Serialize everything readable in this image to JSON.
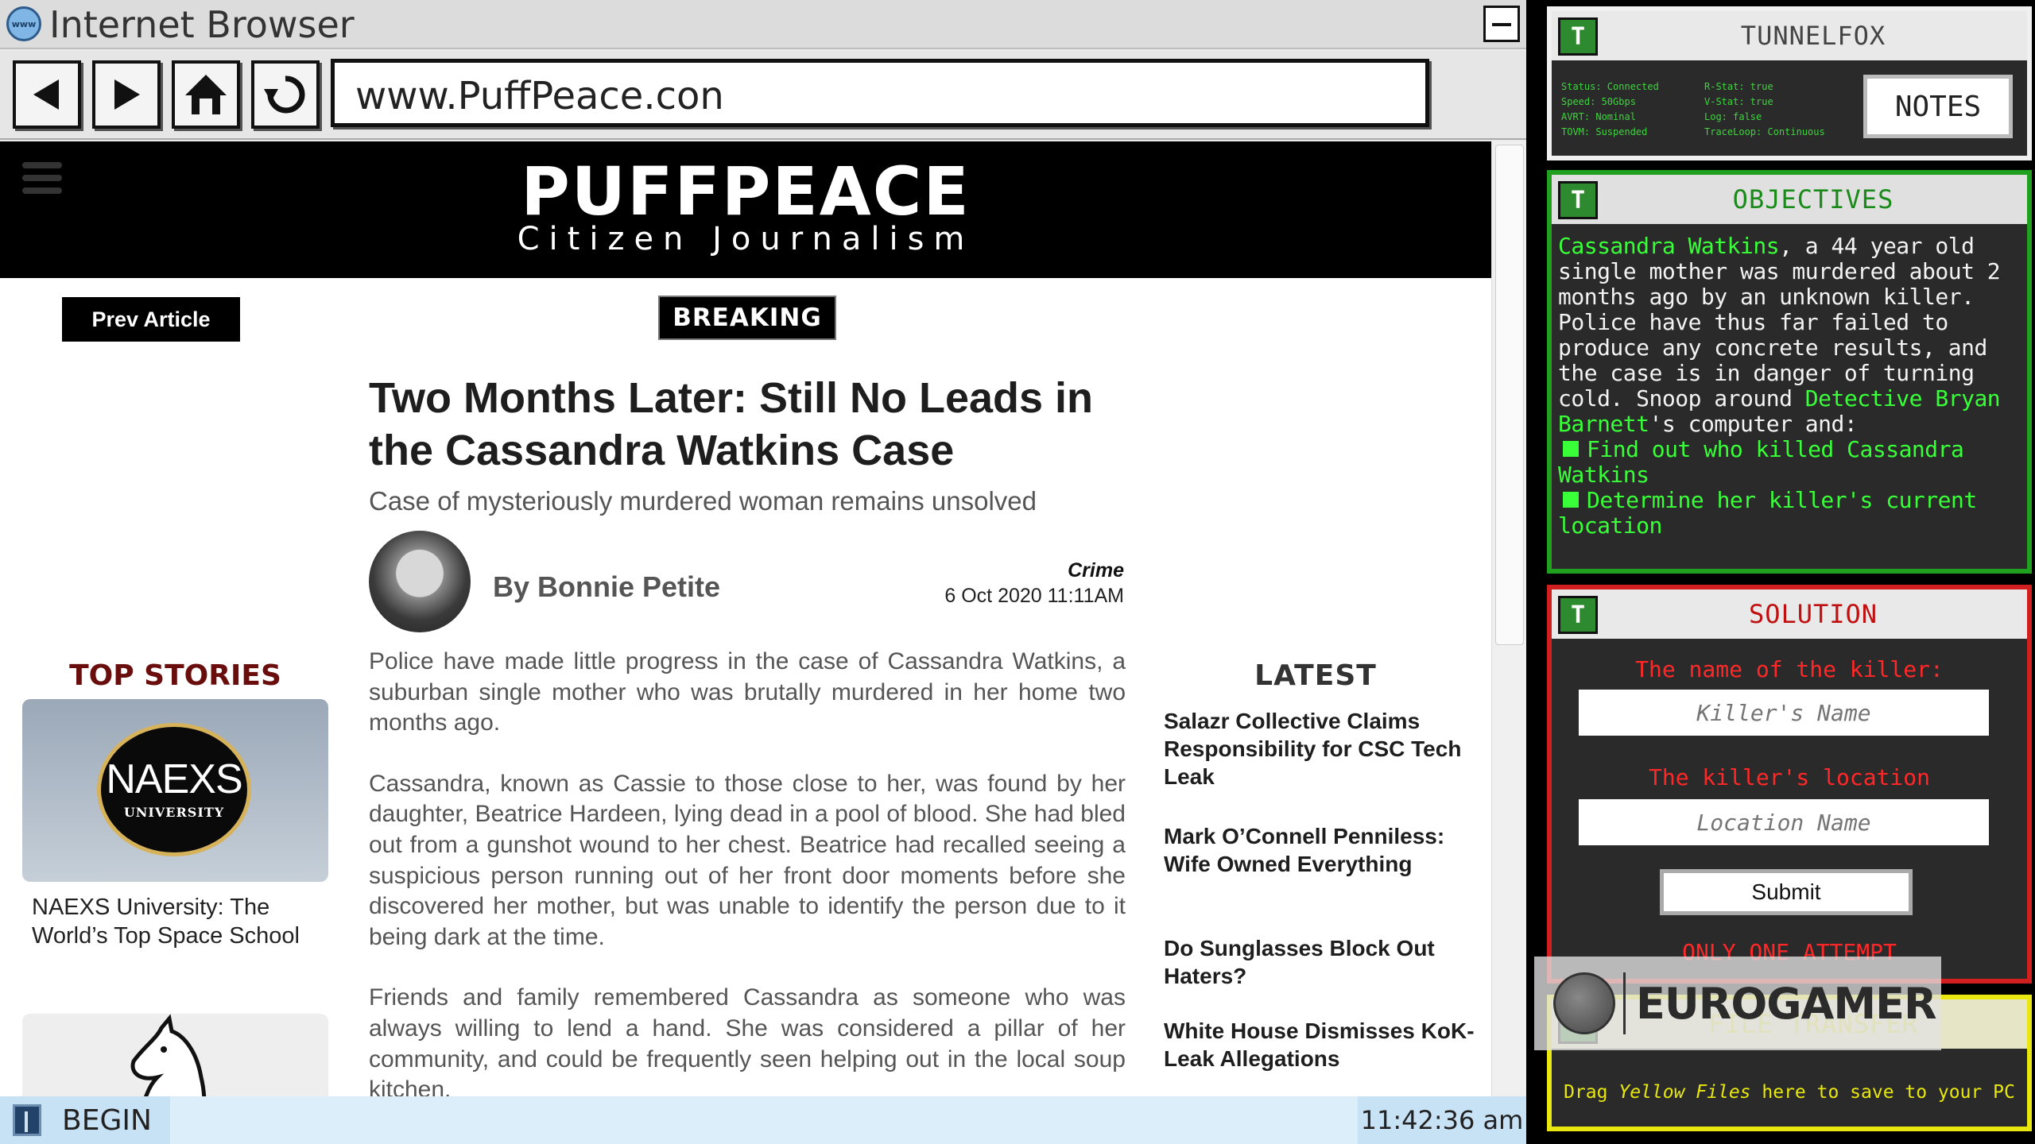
{
  "window": {
    "title": "Internet Browser",
    "icon": "www"
  },
  "navigation": {
    "url": "www.PuffPeace.con"
  },
  "site": {
    "name": "PUFFPEACE",
    "tagline": "Citizen Journalism"
  },
  "article": {
    "prev_label": "Prev Article",
    "badge": "BREAKING",
    "headline": "Two Months Later: Still No Leads in the Cassandra Watkins Case",
    "subheadline": "Case of mysteriously murdered woman remains unsolved",
    "author": "By Bonnie Petite",
    "category": "Crime",
    "date": "6 Oct 2020 11:11AM",
    "paragraphs": [
      "Police have made little progress in the case of Cassandra Watkins, a suburban single mother who was brutally murdered in her home two months ago.",
      "Cassandra, known as Cassie to those close to her, was found by her daughter, Beatrice Hardeen, lying dead in a pool of blood. She had bled out from a gunshot wound to her chest. Beatrice had recalled seeing a suspicious person running out of her front door moments before she discovered her mother, but was unable to identify the person due to it being dark at the time.",
      "Friends and family remembered Cassandra as someone who was always willing to lend a hand. She was considered a pillar of her community, and could be frequently seen helping out in the local soup kitchen."
    ]
  },
  "top_stories": {
    "heading": "TOP STORIES",
    "items": [
      {
        "logo_name": "NAEXS",
        "logo_sub": "UNIVERSITY",
        "caption": "NAEXS University: The World’s Top Space School"
      }
    ]
  },
  "latest": {
    "heading": "LATEST",
    "items": [
      "Salazr Collective Claims Responsibility for CSC Tech Leak",
      "Mark O’Connell Penniless: Wife Owned Everything",
      "Do Sunglasses Block Out Haters?",
      "White House Dismisses KoK-Leak Allegations"
    ]
  },
  "taskbar": {
    "begin": "BEGIN",
    "clock": "11:42:36 am"
  },
  "tunnelfox": {
    "logo": "T",
    "title": "TUNNELFOX",
    "status_left": [
      "Status: Connected",
      "Speed: 50Gbps",
      "AVRT: Nominal",
      "TOVM: Suspended"
    ],
    "status_right": [
      "R-Stat: true",
      "V-Stat: true",
      "Log: false",
      "TraceLoop: Continuous"
    ],
    "notes": "NOTES"
  },
  "objectives": {
    "logo": "T",
    "title": "OBJECTIVES",
    "victim": "Cassandra Watkins",
    "intro": ", a 44 year old single mother was murdered about 2 months ago by an unknown killer. Police have thus far failed to produce any concrete results, and the case is in danger of turning cold. Snoop around ",
    "detective": "Detective Bryan Barnett",
    "outro": "'s computer and:",
    "tasks": [
      "Find out who killed Cassandra Watkins",
      "Determine her killer's current location"
    ]
  },
  "solution": {
    "logo": "T",
    "title": "SOLUTION",
    "killer_label": "The name of the killer:",
    "killer_placeholder": "Killer's Name",
    "location_label": "The killer's location",
    "location_placeholder": "Location Name",
    "submit": "Submit",
    "warning": "ONLY ONE ATTEMPT"
  },
  "file_transfer": {
    "logo": "T",
    "title": "FILE TRANSFER",
    "prefix": "Drag ",
    "highlight": "Yellow Files",
    "suffix": " here to save to your PC"
  },
  "watermark": {
    "text": "EUROGAMER"
  },
  "colors": {
    "objective_highlight": "#38ff38",
    "solution_red": "#ff2828",
    "transfer_yellow": "#e8e810",
    "site_header": "#000000"
  }
}
